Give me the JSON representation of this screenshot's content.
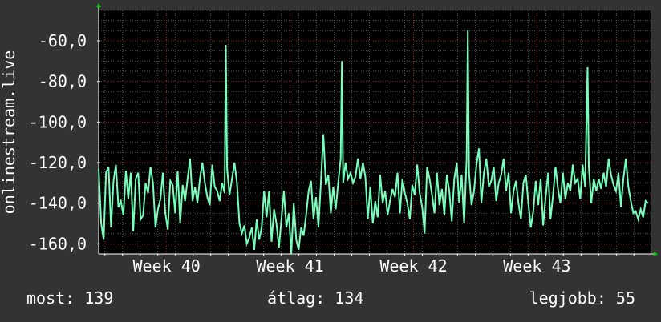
{
  "chart_data": {
    "type": "line",
    "ylabel": "onlinestream.live",
    "ylim": [
      -165,
      -45
    ],
    "yticks": [
      -160,
      -140,
      -120,
      -100,
      -80,
      -60
    ],
    "ytick_labels": [
      "-160,0",
      "-140,0",
      "-120,0",
      "-100,0",
      "-80,0",
      "-60,0"
    ],
    "xlim": [
      39.35,
      43.82
    ],
    "xticks": [
      {
        "label": "Week 40",
        "x": 39.9
      },
      {
        "label": "Week 41",
        "x": 40.9
      },
      {
        "label": "Week 42",
        "x": 41.9
      },
      {
        "label": "Week 43",
        "x": 42.9
      }
    ],
    "grid": true,
    "colors": {
      "background": "#333333",
      "plot": "#000000",
      "line": "#77ffbb",
      "grid_major": "#aa2222",
      "grid_minor": "#555555",
      "axis_arrow": "#00cc00"
    },
    "series": [
      {
        "points": [
          [
            39.35,
            -123
          ],
          [
            39.37,
            -150
          ],
          [
            39.39,
            -158
          ],
          [
            39.41,
            -125
          ],
          [
            39.43,
            -122
          ],
          [
            39.45,
            -152
          ],
          [
            39.47,
            -129
          ],
          [
            39.49,
            -121
          ],
          [
            39.51,
            -142
          ],
          [
            39.53,
            -139
          ],
          [
            39.55,
            -146
          ],
          [
            39.57,
            -124
          ],
          [
            39.59,
            -138
          ],
          [
            39.61,
            -125
          ],
          [
            39.63,
            -154
          ],
          [
            39.65,
            -128
          ],
          [
            39.67,
            -125
          ],
          [
            39.69,
            -148
          ],
          [
            39.71,
            -146
          ],
          [
            39.73,
            -130
          ],
          [
            39.75,
            -135
          ],
          [
            39.77,
            -122
          ],
          [
            39.79,
            -130
          ],
          [
            39.81,
            -152
          ],
          [
            39.83,
            -143
          ],
          [
            39.85,
            -138
          ],
          [
            39.87,
            -125
          ],
          [
            39.89,
            -145
          ],
          [
            39.91,
            -153
          ],
          [
            39.93,
            -129
          ],
          [
            39.95,
            -131
          ],
          [
            39.97,
            -145
          ],
          [
            39.99,
            -124
          ],
          [
            40.01,
            -150
          ],
          [
            40.03,
            -131
          ],
          [
            40.05,
            -139
          ],
          [
            40.07,
            -128
          ],
          [
            40.09,
            -118
          ],
          [
            40.11,
            -139
          ],
          [
            40.13,
            -132
          ],
          [
            40.15,
            -140
          ],
          [
            40.17,
            -128
          ],
          [
            40.19,
            -120
          ],
          [
            40.21,
            -130
          ],
          [
            40.23,
            -137
          ],
          [
            40.25,
            -141
          ],
          [
            40.27,
            -121
          ],
          [
            40.29,
            -132
          ],
          [
            40.31,
            -134
          ],
          [
            40.33,
            -139
          ],
          [
            40.35,
            -130
          ],
          [
            40.37,
            -135
          ],
          [
            40.38,
            -62
          ],
          [
            40.39,
            -123
          ],
          [
            40.41,
            -136
          ],
          [
            40.43,
            -128
          ],
          [
            40.45,
            -120
          ],
          [
            40.47,
            -130
          ],
          [
            40.49,
            -150
          ],
          [
            40.51,
            -155
          ],
          [
            40.53,
            -151
          ],
          [
            40.55,
            -160
          ],
          [
            40.57,
            -157
          ],
          [
            40.59,
            -152
          ],
          [
            40.61,
            -163
          ],
          [
            40.63,
            -148
          ],
          [
            40.65,
            -158
          ],
          [
            40.67,
            -152
          ],
          [
            40.69,
            -134
          ],
          [
            40.71,
            -147
          ],
          [
            40.73,
            -134
          ],
          [
            40.75,
            -159
          ],
          [
            40.77,
            -143
          ],
          [
            40.79,
            -150
          ],
          [
            40.81,
            -162
          ],
          [
            40.83,
            -148
          ],
          [
            40.85,
            -134
          ],
          [
            40.87,
            -152
          ],
          [
            40.89,
            -145
          ],
          [
            40.91,
            -165
          ],
          [
            40.93,
            -140
          ],
          [
            40.95,
            -158
          ],
          [
            40.97,
            -163
          ],
          [
            40.99,
            -152
          ],
          [
            41.01,
            -156
          ],
          [
            41.03,
            -146
          ],
          [
            41.05,
            -134
          ],
          [
            41.07,
            -129
          ],
          [
            41.09,
            -148
          ],
          [
            41.11,
            -137
          ],
          [
            41.13,
            -152
          ],
          [
            41.15,
            -130
          ],
          [
            41.17,
            -106
          ],
          [
            41.19,
            -131
          ],
          [
            41.21,
            -126
          ],
          [
            41.23,
            -145
          ],
          [
            41.25,
            -132
          ],
          [
            41.27,
            -143
          ],
          [
            41.29,
            -130
          ],
          [
            41.31,
            -118
          ],
          [
            41.32,
            -70
          ],
          [
            41.33,
            -130
          ],
          [
            41.35,
            -120
          ],
          [
            41.37,
            -128
          ],
          [
            41.39,
            -125
          ],
          [
            41.41,
            -130
          ],
          [
            41.43,
            -127
          ],
          [
            41.45,
            -118
          ],
          [
            41.47,
            -128
          ],
          [
            41.49,
            -120
          ],
          [
            41.51,
            -127
          ],
          [
            41.53,
            -148
          ],
          [
            41.55,
            -132
          ],
          [
            41.57,
            -150
          ],
          [
            41.59,
            -139
          ],
          [
            41.61,
            -147
          ],
          [
            41.63,
            -126
          ],
          [
            41.65,
            -140
          ],
          [
            41.67,
            -134
          ],
          [
            41.69,
            -146
          ],
          [
            41.71,
            -139
          ],
          [
            41.73,
            -133
          ],
          [
            41.75,
            -137
          ],
          [
            41.77,
            -125
          ],
          [
            41.79,
            -145
          ],
          [
            41.81,
            -128
          ],
          [
            41.83,
            -135
          ],
          [
            41.85,
            -140
          ],
          [
            41.87,
            -148
          ],
          [
            41.89,
            -131
          ],
          [
            41.91,
            -136
          ],
          [
            41.93,
            -121
          ],
          [
            41.95,
            -135
          ],
          [
            41.97,
            -142
          ],
          [
            41.99,
            -155
          ],
          [
            42.01,
            -122
          ],
          [
            42.03,
            -128
          ],
          [
            42.05,
            -136
          ],
          [
            42.07,
            -145
          ],
          [
            42.09,
            -125
          ],
          [
            42.11,
            -141
          ],
          [
            42.13,
            -133
          ],
          [
            42.15,
            -146
          ],
          [
            42.17,
            -126
          ],
          [
            42.19,
            -134
          ],
          [
            42.21,
            -149
          ],
          [
            42.23,
            -128
          ],
          [
            42.25,
            -120
          ],
          [
            42.27,
            -140
          ],
          [
            42.29,
            -126
          ],
          [
            42.31,
            -150
          ],
          [
            42.33,
            -118
          ],
          [
            42.34,
            -55
          ],
          [
            42.35,
            -125
          ],
          [
            42.37,
            -141
          ],
          [
            42.39,
            -134
          ],
          [
            42.41,
            -121
          ],
          [
            42.43,
            -113
          ],
          [
            42.45,
            -140
          ],
          [
            42.47,
            -125
          ],
          [
            42.49,
            -118
          ],
          [
            42.51,
            -132
          ],
          [
            42.53,
            -129
          ],
          [
            42.55,
            -122
          ],
          [
            42.57,
            -139
          ],
          [
            42.59,
            -130
          ],
          [
            42.61,
            -126
          ],
          [
            42.63,
            -118
          ],
          [
            42.65,
            -134
          ],
          [
            42.67,
            -125
          ],
          [
            42.69,
            -145
          ],
          [
            42.71,
            -134
          ],
          [
            42.73,
            -129
          ],
          [
            42.75,
            -140
          ],
          [
            42.77,
            -148
          ],
          [
            42.79,
            -130
          ],
          [
            42.81,
            -126
          ],
          [
            42.83,
            -140
          ],
          [
            42.85,
            -152
          ],
          [
            42.87,
            -144
          ],
          [
            42.89,
            -129
          ],
          [
            42.91,
            -141
          ],
          [
            42.93,
            -128
          ],
          [
            42.95,
            -151
          ],
          [
            42.97,
            -137
          ],
          [
            42.99,
            -125
          ],
          [
            43.01,
            -148
          ],
          [
            43.03,
            -136
          ],
          [
            43.05,
            -122
          ],
          [
            43.07,
            -133
          ],
          [
            43.09,
            -140
          ],
          [
            43.11,
            -125
          ],
          [
            43.13,
            -138
          ],
          [
            43.15,
            -130
          ],
          [
            43.17,
            -134
          ],
          [
            43.19,
            -121
          ],
          [
            43.21,
            -130
          ],
          [
            43.23,
            -128
          ],
          [
            43.25,
            -138
          ],
          [
            43.27,
            -121
          ],
          [
            43.29,
            -132
          ],
          [
            43.31,
            -73
          ],
          [
            43.32,
            -122
          ],
          [
            43.34,
            -140
          ],
          [
            43.36,
            -128
          ],
          [
            43.38,
            -134
          ],
          [
            43.4,
            -128
          ],
          [
            43.42,
            -133
          ],
          [
            43.44,
            -125
          ],
          [
            43.46,
            -132
          ],
          [
            43.48,
            -118
          ],
          [
            43.5,
            -126
          ],
          [
            43.52,
            -131
          ],
          [
            43.54,
            -134
          ],
          [
            43.56,
            -125
          ],
          [
            43.58,
            -142
          ],
          [
            43.6,
            -128
          ],
          [
            43.62,
            -118
          ],
          [
            43.64,
            -132
          ],
          [
            43.66,
            -139
          ],
          [
            43.68,
            -145
          ],
          [
            43.7,
            -144
          ],
          [
            43.72,
            -148
          ],
          [
            43.74,
            -143
          ],
          [
            43.76,
            -147
          ],
          [
            43.78,
            -139
          ],
          [
            43.8,
            -140
          ]
        ]
      }
    ]
  },
  "footer": {
    "now": "most: 139",
    "avg": "átlag: 134",
    "best": "legjobb: 55"
  }
}
